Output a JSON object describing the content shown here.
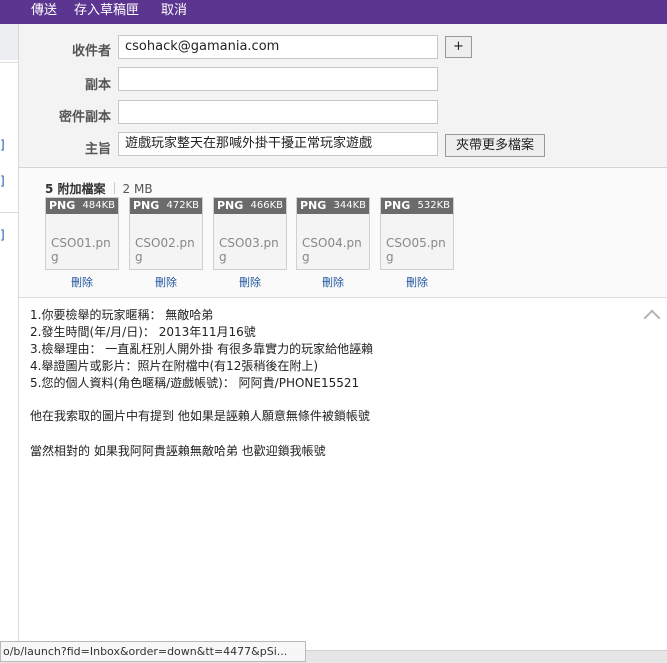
{
  "toolbar": {
    "send": "傳送",
    "save_draft": "存入草稿匣",
    "cancel": "取消"
  },
  "compose": {
    "to_label": "收件者",
    "to_value": "csohack@gamania.com",
    "add_recipient": "+",
    "cc_label": "副本",
    "cc_value": "",
    "bcc_label": "密件副本",
    "bcc_value": "",
    "subject_label": "主旨",
    "subject_value": "遊戲玩家整天在那喊外掛干擾正常玩家遊戲",
    "attach_more": "夾帶更多檔案"
  },
  "sidebar": {
    "marks": [
      "]",
      "]",
      "]"
    ]
  },
  "attachments": {
    "count_label": "5 附加檔案",
    "total_size": "2 MB",
    "delete_label": "刪除",
    "files": [
      {
        "type": "PNG",
        "size": "484KB",
        "name": "CSO01.png"
      },
      {
        "type": "PNG",
        "size": "472KB",
        "name": "CSO02.png"
      },
      {
        "type": "PNG",
        "size": "466KB",
        "name": "CSO03.png"
      },
      {
        "type": "PNG",
        "size": "344KB",
        "name": "CSO04.png"
      },
      {
        "type": "PNG",
        "size": "532KB",
        "name": "CSO05.png"
      }
    ]
  },
  "body": {
    "lines": [
      "1.你要檢舉的玩家暱稱： 無敵哈弟",
      "2.發生時間(年/月/日)： 2013年11月16號",
      "3.檢舉理由： 一直亂枉別人開外掛 有很多靠實力的玩家給他誣賴",
      "4.舉證圖片或影片：照片在附檔中(有12張稍後在附上)",
      "5.您的個人資料(角色暱稱/遊戲帳號)： 阿阿貴/PHONE15521",
      "他在我索取的圖片中有提到 他如果是誣賴人願意無條件被鎖帳號",
      "當然相對的 如果我阿阿貴誣賴無敵哈弟 也歡迎鎖我帳號"
    ]
  },
  "status": {
    "url": "o/b/launch?fid=Inbox&order=down&tt=4477&pSi..."
  }
}
